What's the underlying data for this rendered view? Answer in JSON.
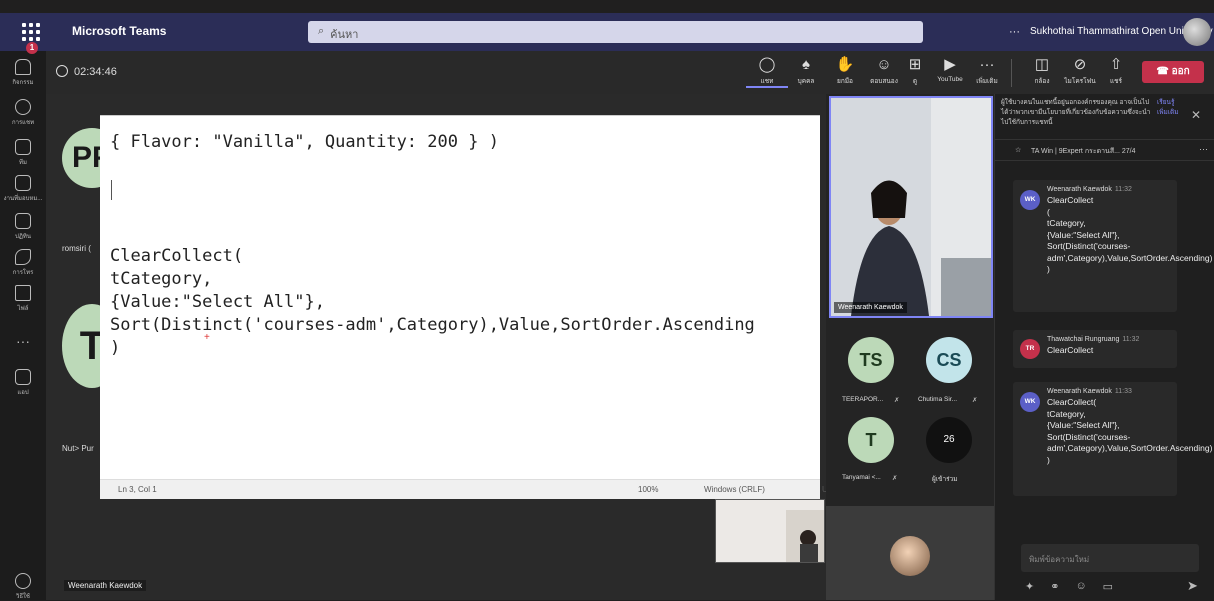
{
  "titlebar": {
    "app_name": "Microsoft Teams",
    "search_placeholder": "ค้นหา",
    "more": "···",
    "org_name": "Sukhothai Thammathirat Open University"
  },
  "rail": {
    "items": [
      {
        "label": "กิจกรรม",
        "icon": "bell-icon"
      },
      {
        "label": "การแชท",
        "icon": "chat-icon"
      },
      {
        "label": "ทีม",
        "icon": "teams-icon"
      },
      {
        "label": "งานที่มอบหม...",
        "icon": "assignments-icon"
      },
      {
        "label": "ปฏิทิน",
        "icon": "calendar-icon"
      },
      {
        "label": "การโทร",
        "icon": "phone-icon"
      },
      {
        "label": "ไฟล์",
        "icon": "file-icon"
      },
      {
        "label": "",
        "icon": "more-icon"
      },
      {
        "label": "แอป",
        "icon": "apps-icon"
      }
    ],
    "help_label": "วิธีใช้",
    "badge": "1"
  },
  "meeting": {
    "timer": "02:34:46",
    "controls": [
      {
        "label": "แชท",
        "glyph": "💬",
        "icon": "chat-icon"
      },
      {
        "label": "บุคคล",
        "glyph": "👥",
        "icon": "people-icon"
      },
      {
        "label": "ยกมือ",
        "glyph": "✋",
        "icon": "raise-hand-icon"
      },
      {
        "label": "ตอบสนอง",
        "glyph": "☺",
        "icon": "react-icon"
      },
      {
        "label": "ดู",
        "glyph": "⊞",
        "icon": "view-icon"
      },
      {
        "label": "YouTube",
        "glyph": "▶",
        "icon": "youtube-icon"
      },
      {
        "label": "เพิ่มเติม",
        "glyph": "···",
        "icon": "more-icon"
      },
      {
        "label": "กล้อง",
        "glyph": "⊘",
        "icon": "camera-off-icon"
      },
      {
        "label": "ไมโครโฟน",
        "glyph": "🎙",
        "icon": "mic-off-icon"
      },
      {
        "label": "แชร์",
        "glyph": "⇧",
        "icon": "share-icon"
      }
    ],
    "leave_label": "ออก"
  },
  "stage": {
    "tile_initials_top": "PP",
    "tile_initials_mid": "T",
    "tile_name_1": "romsiri (",
    "tile_name_2": "Nut> Pur",
    "presenter_name": "Weenarath Kaewdok"
  },
  "editor": {
    "line1": "{ Flavor: \"Vanilla\", Quantity: 200 } )",
    "code": [
      "ClearCollect(",
      "tCategory,",
      "{Value:\"Select All\"},",
      "Sort(Distinct('courses-adm',Category),Value,SortOrder.Ascending",
      ")"
    ],
    "status_position": "Ln 3, Col 1",
    "status_zoom": "100%",
    "status_eol": "Windows (CRLF)",
    "status_more": "U"
  },
  "participants": {
    "featured_name": "Weenarath Kaewdok",
    "list": [
      {
        "initials": "TS",
        "name": "TEERAPOR...",
        "color": "#bcd9b8"
      },
      {
        "initials": "CS",
        "name": "Chutima Sir...",
        "color": "#c2e4ea"
      },
      {
        "initials": "T",
        "name": "Tanyamai <...",
        "color": "#bcd9b8"
      }
    ],
    "more_count": "26",
    "more_label": "ผู้เข้าร่วม"
  },
  "chat": {
    "notice": "ผู้ใช้บางคนในแชทนี้อยู่นอกองค์กรของคุณ อาจเป็นไปได้ว่าพวกเขามีนโยบายที่เกี่ยวข้องกับข้อความซึ่งจะนำไปใช้กับการแชทนี้",
    "notice_link": "เรียนรู้เพิ่มเติม",
    "pinned": "TA Win | 9Expert กระดานสี... 27/4",
    "messages": [
      {
        "initials": "WK",
        "author": "Weenarath Kaewdok",
        "time": "11:32",
        "body": "ClearCollect\n(\ntCategory,\n{Value:\"Select All\"},\nSort(Distinct('courses-adm',Category),Value,SortOrder.Ascending)\n)",
        "color": "#5b5fc7"
      },
      {
        "initials": "TR",
        "author": "Thawatchai Rungruang",
        "time": "11:32",
        "body": "ClearCollect",
        "color": "#c4314b"
      },
      {
        "initials": "WK",
        "author": "Weenarath Kaewdok",
        "time": "11:33",
        "body": "ClearCollect(\ntCategory,\n{Value:\"Select All\"},\nSort(Distinct('courses-adm',Category),Value,SortOrder.Ascending)\n)",
        "color": "#5b5fc7"
      }
    ],
    "compose_placeholder": "พิมพ์ข้อความใหม่"
  },
  "colors": {
    "accent": "#7f85f5",
    "leave": "#c4314b",
    "titlebar": "#2b2d57"
  }
}
